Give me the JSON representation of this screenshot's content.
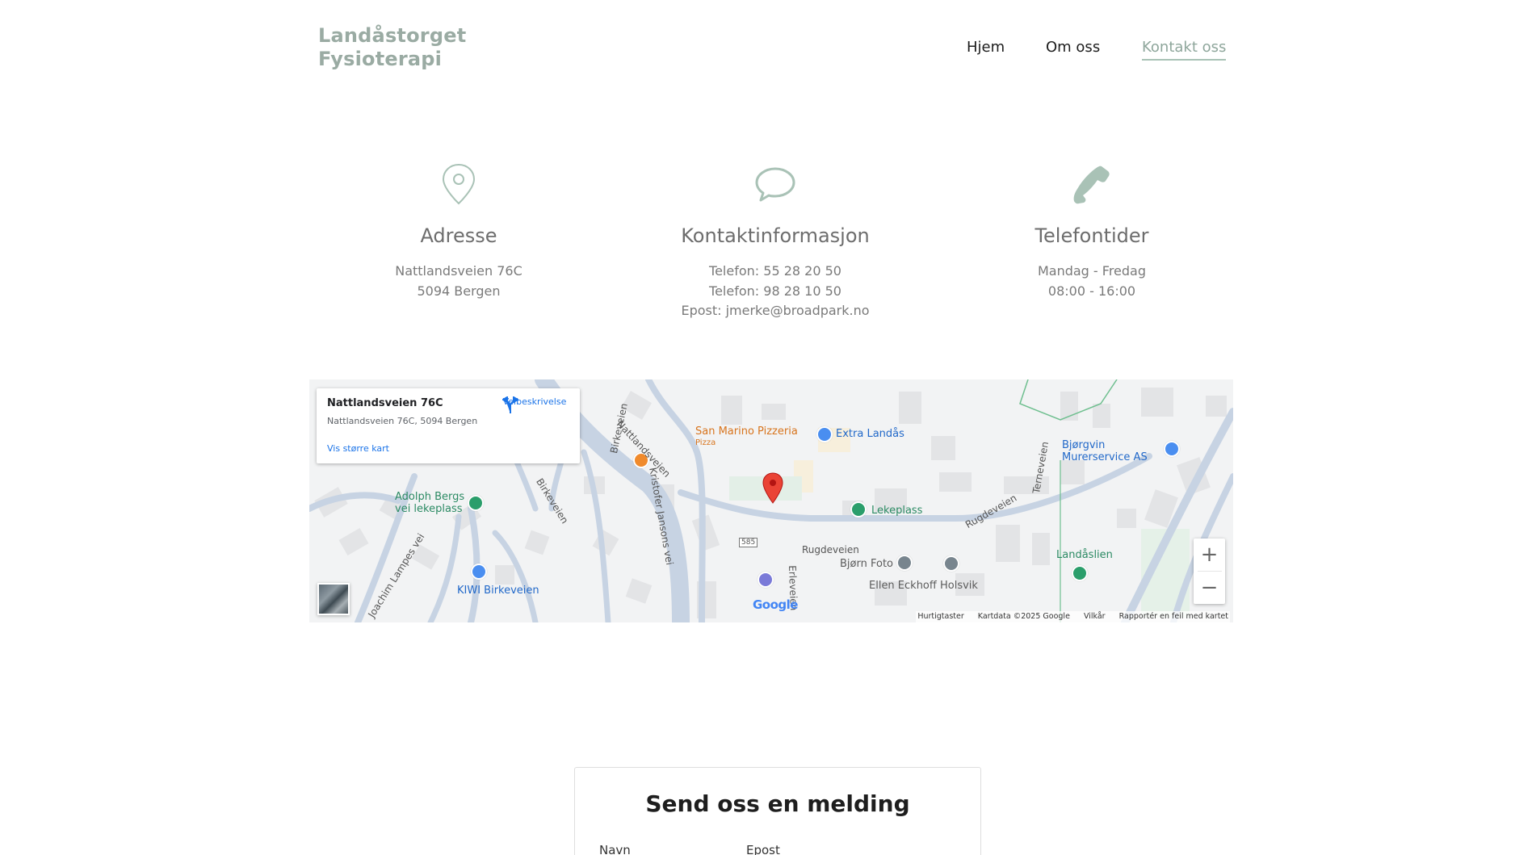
{
  "brand": {
    "line1": "Landåstorget",
    "line2": "Fysioterapi"
  },
  "nav": {
    "items": [
      "Hjem",
      "Om oss",
      "Kontakt oss"
    ],
    "active": "Kontakt oss"
  },
  "info": {
    "address": {
      "icon": "location-pin-icon",
      "title": "Adresse",
      "lines": [
        "Nattlandsveien 76C",
        "5094 Bergen"
      ]
    },
    "contact": {
      "icon": "chat-bubble-icon",
      "title": "Kontaktinformasjon",
      "lines": [
        "Telefon: 55 28 20 50",
        "Telefon: 98 28 10 50",
        "Epost: jmerke@broadpark.no"
      ]
    },
    "phone": {
      "icon": "phone-icon",
      "title": "Telefontider",
      "lines": [
        "Mandag - Fredag",
        "08:00 - 16:00"
      ]
    }
  },
  "map": {
    "card": {
      "title": "Nattlandsveien 76C",
      "address": "Nattlandsveien 76C, 5094 Bergen",
      "directions": "Veibeskrivelse",
      "larger_map": "Vis større kart"
    },
    "places": {
      "pizzeria": "San Marino Pizzeria",
      "pizzeria_sub": "Pizza",
      "extra": "Extra Landås",
      "bjorgvin_1": "Bjørgvin",
      "bjorgvin_2": "Murerservice AS",
      "adolph_1": "Adolph Bergs",
      "adolph_2": "vei lekeplass",
      "lekeplass": "Lekeplass",
      "landaslien": "Landåslien",
      "kiwi": "KIWI Birkeveien",
      "bjorn": "Bjørn Foto",
      "ellen": "Ellen Eckhoff Holsvik"
    },
    "streets": {
      "nattlandsveien": "Nattlandsveien",
      "kristofer": "Kristofer Jansons vei",
      "birkeveien": "Birkeveien",
      "rugdeveien": "Rugdeveien",
      "erleveien": "Erleveien",
      "ternevegen": "Terneveien",
      "joachim": "Joachim Lampes vei",
      "road_number": "585"
    },
    "zoom_in": "+",
    "zoom_out": "−",
    "attribution": [
      "Hurtigtaster",
      "Kartdata ©2025 Google",
      "Vilkår",
      "Rapportér en feil med kartet"
    ],
    "google": "Google"
  },
  "form": {
    "title": "Send oss en melding",
    "name_label": "Navn",
    "email_label": "Epost"
  },
  "colors": {
    "accent": "#a9c2b6",
    "brand": "#9aaba3",
    "text_dark": "#1c1c1c"
  }
}
